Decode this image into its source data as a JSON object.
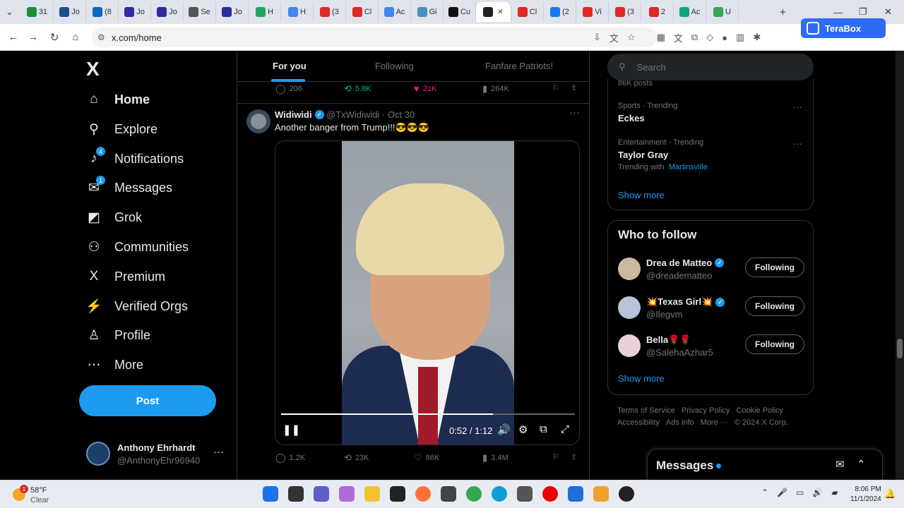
{
  "browser": {
    "tabs": [
      {
        "label": "31",
        "color": "#1e8e3e"
      },
      {
        "label": "Jo",
        "color": "#1b4f8c"
      },
      {
        "label": "(8",
        "color": "#0a66c2"
      },
      {
        "label": "Jo",
        "color": "#2b2d9e"
      },
      {
        "label": "Jo",
        "color": "#2b2d9e"
      },
      {
        "label": "Se",
        "color": "#555555"
      },
      {
        "label": "Jo",
        "color": "#2b2d9e"
      },
      {
        "label": "H",
        "color": "#1fa463"
      },
      {
        "label": "H",
        "color": "#4285f4"
      },
      {
        "label": "(3",
        "color": "#e02828"
      },
      {
        "label": "Cl",
        "color": "#e02828"
      },
      {
        "label": "Ac",
        "color": "#4285f4"
      },
      {
        "label": "Gi",
        "color": "#4a90c2"
      },
      {
        "label": "Cu",
        "color": "#111111"
      },
      {
        "label": "",
        "color": "#222222",
        "active": true
      },
      {
        "label": "Cl",
        "color": "#e02828"
      },
      {
        "label": "(2",
        "color": "#1877f2"
      },
      {
        "label": "Vi",
        "color": "#e02828"
      },
      {
        "label": "(3",
        "color": "#e02828"
      },
      {
        "label": "2",
        "color": "#e02828"
      },
      {
        "label": "Ac",
        "color": "#10a37f"
      },
      {
        "label": "U",
        "color": "#34a853"
      }
    ],
    "url": "x.com/home",
    "extension_label": "TeraBox"
  },
  "sidebar": {
    "logo": "X",
    "items": [
      {
        "label": "Home",
        "icon": "home-icon",
        "glyph": "⌂"
      },
      {
        "label": "Explore",
        "icon": "search-icon",
        "glyph": "⚲"
      },
      {
        "label": "Notifications",
        "icon": "bell-icon",
        "glyph": "♪",
        "badge": "4"
      },
      {
        "label": "Messages",
        "icon": "envelope-icon",
        "glyph": "✉",
        "badge": "1"
      },
      {
        "label": "Grok",
        "icon": "grok-icon",
        "glyph": "◩"
      },
      {
        "label": "Communities",
        "icon": "people-icon",
        "glyph": "⚇"
      },
      {
        "label": "Premium",
        "icon": "x-premium-icon",
        "glyph": "X"
      },
      {
        "label": "Verified Orgs",
        "icon": "lightning-icon",
        "glyph": "⚡"
      },
      {
        "label": "Profile",
        "icon": "person-icon",
        "glyph": "♙"
      },
      {
        "label": "More",
        "icon": "more-circle-icon",
        "glyph": "⋯"
      }
    ],
    "post_label": "Post",
    "account": {
      "name": "Anthony Ehrhardt",
      "handle": "@AnthonyEhr96940"
    }
  },
  "feed": {
    "tabs": [
      "For you",
      "Following",
      "Fanfare Patriots!"
    ],
    "prev_actions": {
      "replies": "206",
      "reposts": "5.8K",
      "likes": "21K",
      "views": "264K"
    },
    "tweet": {
      "name": "Widiwidi",
      "handle": "@TxWidiwidi",
      "date": "Oct 30",
      "text": "Another banger from Trump!!!😎😎😎",
      "video": {
        "time": "0:52 / 1:12",
        "progress": 0.72
      },
      "actions": {
        "replies": "1.2K",
        "reposts": "23K",
        "likes": "86K",
        "views": "3.4M"
      }
    }
  },
  "right": {
    "search_placeholder": "Search",
    "trends": [
      {
        "top_note": "86K posts"
      },
      {
        "meta": "Sports · Trending",
        "title": "Eckes"
      },
      {
        "meta": "Entertainment · Trending",
        "title": "Taylor Gray",
        "sub": "Trending with",
        "sub_link": "Martinsville"
      }
    ],
    "show_more": "Show more",
    "who_to_follow": {
      "title": "Who to follow",
      "users": [
        {
          "name": "Drea de Matteo",
          "handle": "@dreadematteo",
          "button": "Following",
          "verified": true
        },
        {
          "name": "💥Texas Girl💥",
          "handle": "@Ilegvm",
          "button": "Following",
          "verified": true
        },
        {
          "name": "Bella🌹🌹",
          "handle": "@SalehaAzhar5",
          "button": "Following",
          "verified": false
        }
      ],
      "show_more": "Show more"
    },
    "footer": [
      "Terms of Service",
      "Privacy Policy",
      "Cookie Policy",
      "Accessibility",
      "Ads info",
      "More ···",
      "© 2024 X Corp."
    ]
  },
  "messages_dock": {
    "title": "Messages"
  },
  "taskbar": {
    "weather": {
      "badge": "1",
      "temp": "58°F",
      "condition": "Clear"
    },
    "time": "8:06 PM",
    "date": "11/1/2024"
  }
}
